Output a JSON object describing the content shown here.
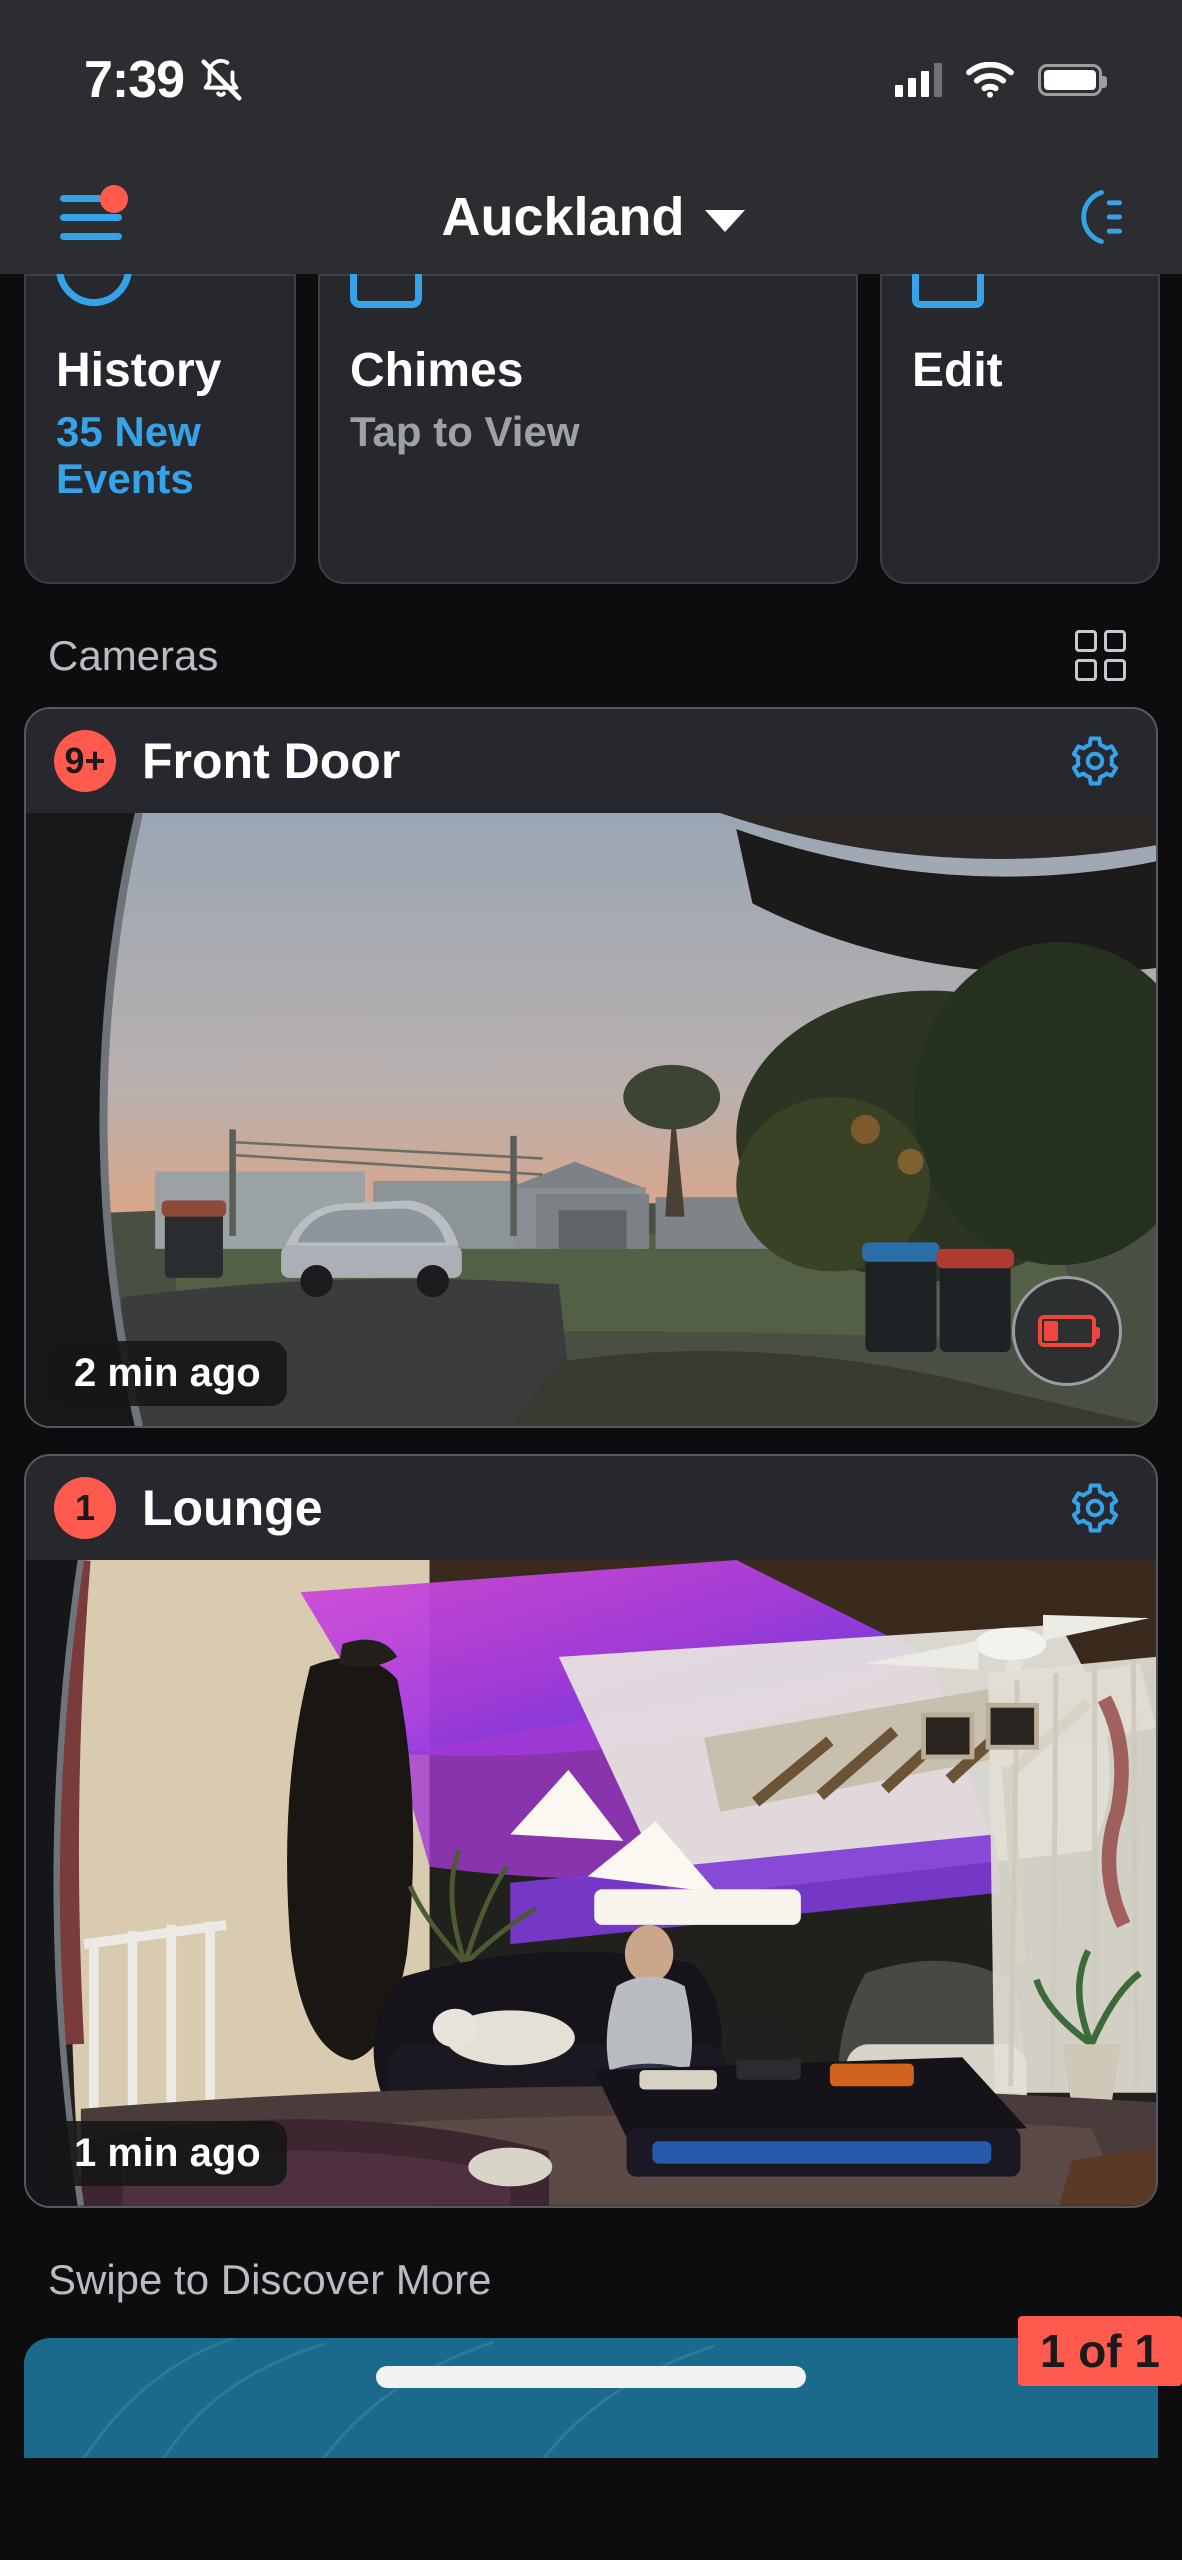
{
  "status_bar": {
    "time": "7:39",
    "mute_icon": "bell-slash-icon",
    "signal_icon": "cellular-signal-icon",
    "wifi_icon": "wifi-icon",
    "battery_icon": "battery-icon"
  },
  "header": {
    "menu_icon": "hamburger-menu-icon",
    "has_notification_dot": true,
    "title": "Auckland",
    "dropdown_icon": "chevron-down-icon",
    "mode_icon": "moon-night-mode-icon",
    "accent_color": "#35a3e8",
    "notification_color": "#ff5a4d"
  },
  "quick_actions": [
    {
      "icon": "clock-history-icon",
      "title": "History",
      "subtitle": "35 New Events",
      "subtitle_style": "blue"
    },
    {
      "icon": "bell-chime-icon",
      "title": "Chimes",
      "subtitle": "Tap to View",
      "subtitle_style": "gray"
    },
    {
      "icon": "pencil-edit-icon",
      "title": "Edit",
      "subtitle": "",
      "subtitle_style": "gray"
    }
  ],
  "cameras_section": {
    "label": "Cameras",
    "layout_toggle_icon": "grid-view-icon"
  },
  "cameras": [
    {
      "badge": "9+",
      "name": "Front Door",
      "settings_icon": "gear-icon",
      "timestamp": "2 min ago",
      "battery_low": true,
      "battery_icon": "low-battery-icon"
    },
    {
      "badge": "1",
      "name": "Lounge",
      "settings_icon": "gear-icon",
      "timestamp": "1 min ago",
      "battery_low": false,
      "battery_icon": ""
    }
  ],
  "footer": {
    "swipe_label": "Swipe to Discover More",
    "page_indicator": "1 of 1",
    "promo_color": "#1b6a8c"
  }
}
